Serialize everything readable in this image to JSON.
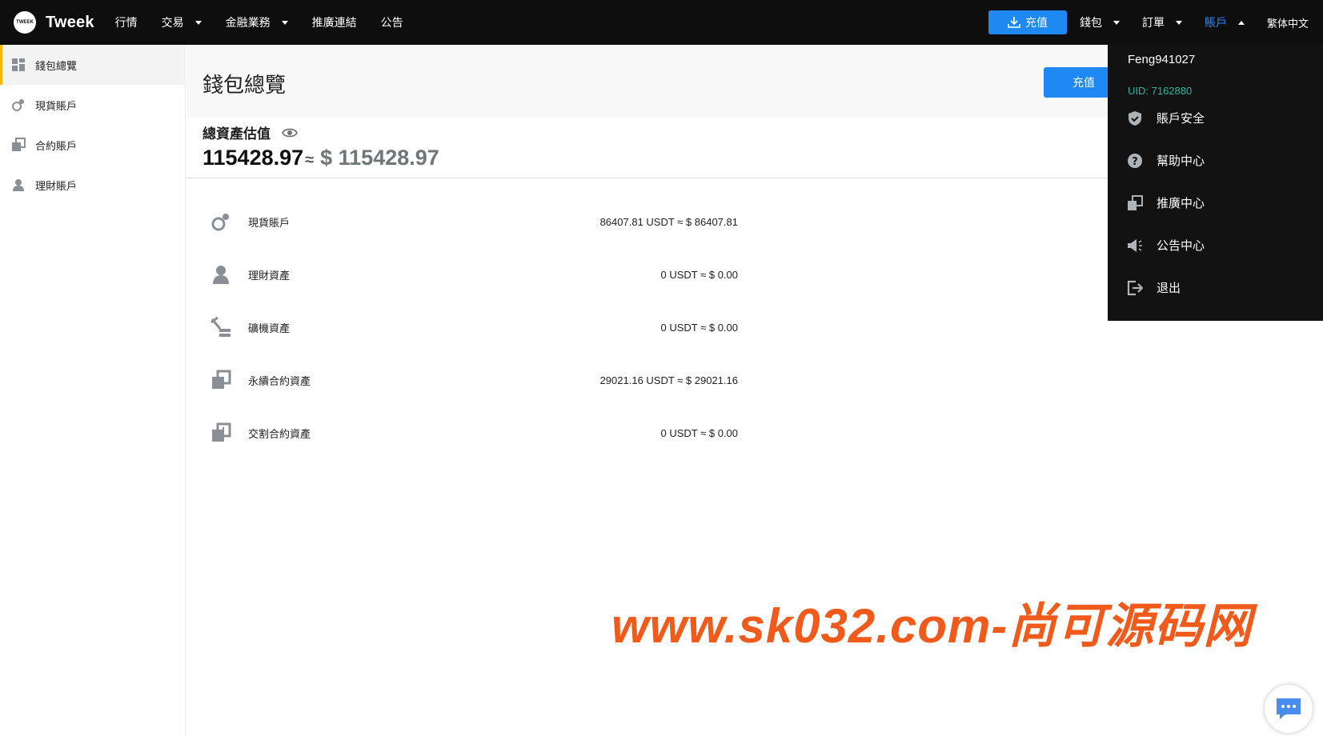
{
  "brand": {
    "name": "Tweek",
    "badge_text": "TWEEK"
  },
  "nav": {
    "items": [
      {
        "label": "行情",
        "dropdown": false
      },
      {
        "label": "交易",
        "dropdown": true
      },
      {
        "label": "金融業務",
        "dropdown": true
      },
      {
        "label": "推廣連結",
        "dropdown": false
      },
      {
        "label": "公告",
        "dropdown": false
      }
    ],
    "deposit_label": "充值",
    "wallet_label": "錢包",
    "orders_label": "訂單",
    "account_label": "賬戶",
    "language_label": "繁体中文"
  },
  "sidebar": {
    "items": [
      {
        "label": "錢包總覽",
        "icon": "grid-icon",
        "active": true
      },
      {
        "label": "現貨賬戶",
        "icon": "spot-icon",
        "active": false
      },
      {
        "label": "合約賬戶",
        "icon": "contract-icon",
        "active": false
      },
      {
        "label": "理財賬戶",
        "icon": "finance-icon",
        "active": false
      }
    ]
  },
  "page": {
    "title": "錢包總覽",
    "deposit_label": "充值",
    "summary_label": "總資產估值",
    "total_value": "115428.97",
    "approx_symbol": "≈",
    "total_usd": "$ 115428.97"
  },
  "assets": [
    {
      "name": "現貨賬戶",
      "value": "86407.81 USDT ≈ $ 86407.81",
      "icon": "spot-icon"
    },
    {
      "name": "理財資產",
      "value": "0 USDT ≈ $ 0.00",
      "icon": "finance-icon"
    },
    {
      "name": "礦機資產",
      "value": "0 USDT ≈ $ 0.00",
      "icon": "mining-icon"
    },
    {
      "name": "永續合約資產",
      "value": "29021.16 USDT ≈ $ 29021.16",
      "icon": "contract-icon"
    },
    {
      "name": "交割合約資產",
      "value": "0 USDT ≈ $ 0.00",
      "icon": "delivery-contract-icon"
    }
  ],
  "account_menu": {
    "username": "Feng941027",
    "uid": "UID: 7162880",
    "items": [
      {
        "label": "賬戶安全",
        "icon": "shield-icon"
      },
      {
        "label": "幫助中心",
        "icon": "help-icon"
      },
      {
        "label": "推廣中心",
        "icon": "referral-icon"
      },
      {
        "label": "公告中心",
        "icon": "megaphone-icon"
      },
      {
        "label": "退出",
        "icon": "logout-icon"
      }
    ]
  },
  "watermark": "www.sk032.com-尚可源码网",
  "colors": {
    "accent": "#1e88f3",
    "active_border": "#f0b90b",
    "uid": "#2ab5a0",
    "watermark": "#f05a1a"
  }
}
